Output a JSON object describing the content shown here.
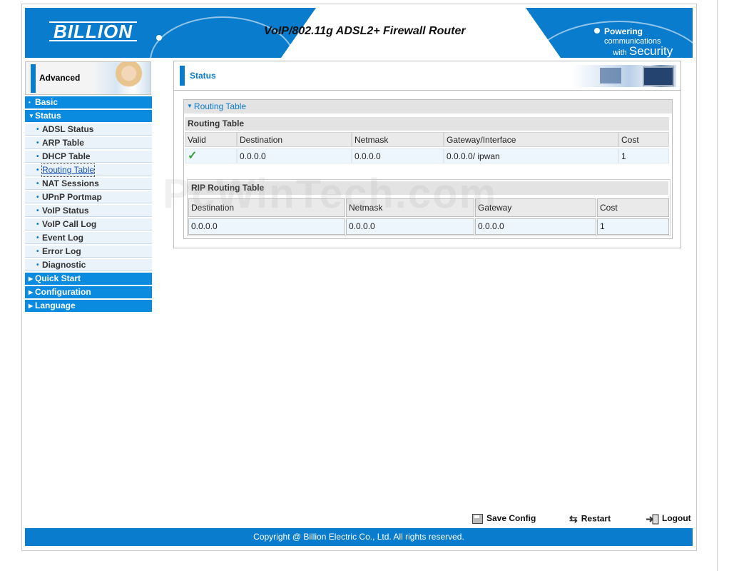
{
  "brand": {
    "logo": "BILLION",
    "product": "VoIP/802.11g ADSL2+ Firewall Router",
    "slogan_1": "Powering",
    "slogan_2": "communications",
    "slogan_3": "with",
    "slogan_4": "Security"
  },
  "sidebar": {
    "mode_label": "Advanced",
    "items": [
      {
        "label": "Basic",
        "type": "top",
        "marker": "•"
      },
      {
        "label": "Status",
        "type": "top",
        "marker": "▼"
      },
      {
        "label": "ADSL Status",
        "type": "sub"
      },
      {
        "label": "ARP Table",
        "type": "sub"
      },
      {
        "label": "DHCP Table",
        "type": "sub"
      },
      {
        "label": "Routing Table",
        "type": "sub",
        "active": true
      },
      {
        "label": "NAT Sessions",
        "type": "sub"
      },
      {
        "label": "UPnP Portmap",
        "type": "sub"
      },
      {
        "label": "VoIP Status",
        "type": "sub"
      },
      {
        "label": "VoIP Call Log",
        "type": "sub"
      },
      {
        "label": "Event Log",
        "type": "sub"
      },
      {
        "label": "Error Log",
        "type": "sub"
      },
      {
        "label": "Diagnostic",
        "type": "sub"
      },
      {
        "label": "Quick Start",
        "type": "top",
        "marker": "▶"
      },
      {
        "label": "Configuration",
        "type": "top",
        "marker": "▶"
      },
      {
        "label": "Language",
        "type": "top",
        "marker": "▶"
      }
    ]
  },
  "main": {
    "page_title": "Status",
    "section_title": "Routing Table",
    "routing": {
      "title": "Routing Table",
      "columns": [
        "Valid",
        "Destination",
        "Netmask",
        "Gateway/Interface",
        "Cost"
      ],
      "rows": [
        {
          "valid": "✓",
          "destination": "0.0.0.0",
          "netmask": "0.0.0.0",
          "gateway": "0.0.0.0/ ipwan",
          "cost": "1"
        }
      ]
    },
    "rip": {
      "title": "RIP Routing Table",
      "columns": [
        "Destination",
        "Netmask",
        "Gateway",
        "Cost"
      ],
      "rows": [
        {
          "destination": "0.0.0.0",
          "netmask": "0.0.0.0",
          "gateway": "0.0.0.0",
          "cost": "1"
        }
      ]
    }
  },
  "watermark": "PcWinTech.com",
  "footer": {
    "save_label": "Save Config",
    "restart_label": "Restart",
    "logout_label": "Logout",
    "copyright": "Copyright @ Billion Electric Co., Ltd. All rights reserved."
  },
  "colors": {
    "accent": "#0a7ccd",
    "nav_top": "#0a8be0",
    "row_bg": "#edf5fd",
    "check": "#3aa23a"
  }
}
